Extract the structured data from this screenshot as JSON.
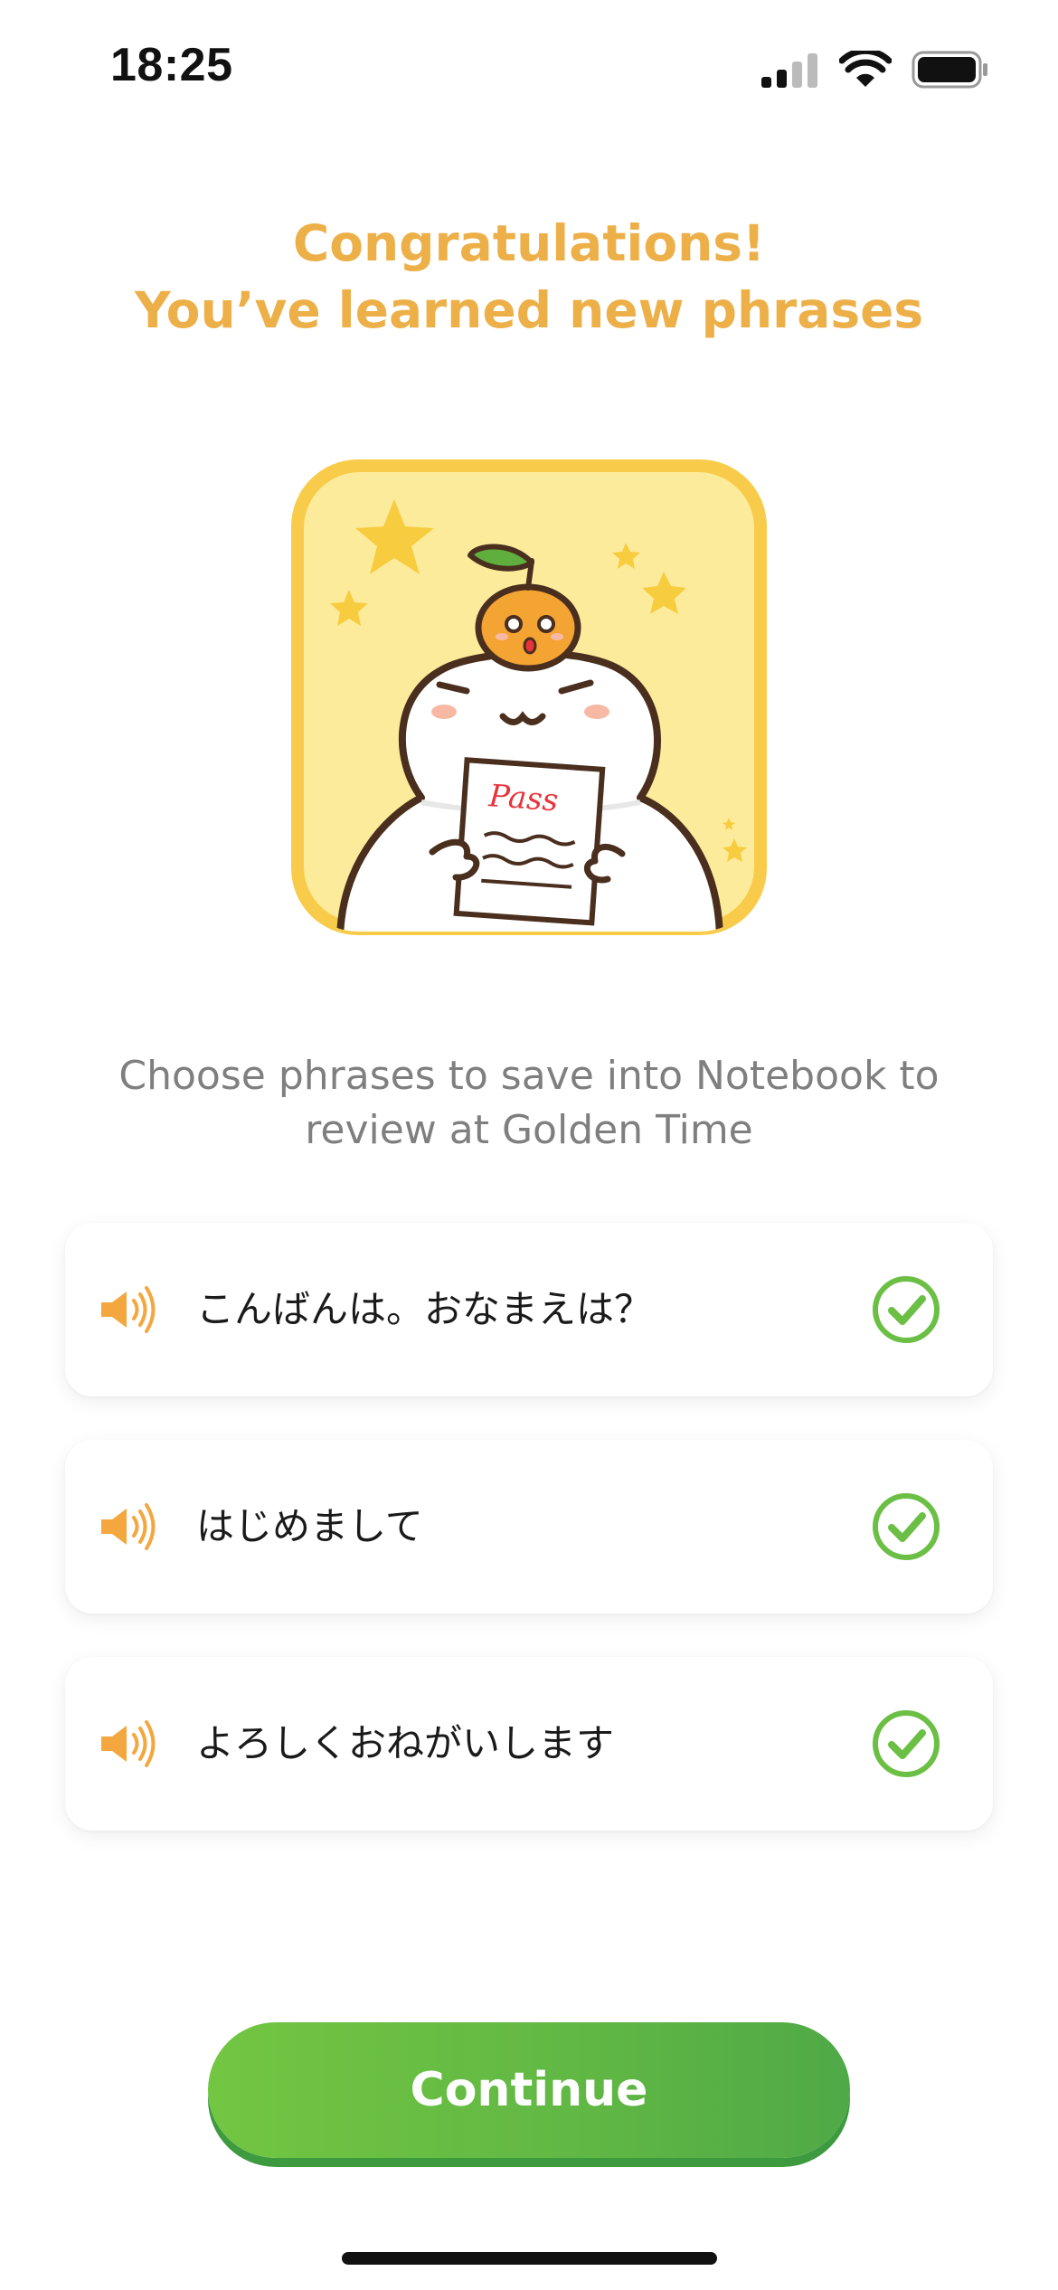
{
  "status_bar": {
    "time": "18:25",
    "icons": [
      "cellular-signal-icon",
      "wifi-icon",
      "battery-icon"
    ]
  },
  "headline": {
    "line1": "Congratulations!",
    "line2": "You’ve learned new phrases"
  },
  "illustration": {
    "name": "mascot-pass-illustration",
    "paper_text": "Pass"
  },
  "instruction": {
    "line1": "Choose phrases to save into Notebook to",
    "line2": "review at Golden Time"
  },
  "phrases": [
    {
      "text": "こんばんは。おなまえは？",
      "selected": true
    },
    {
      "text": "はじめまして",
      "selected": true
    },
    {
      "text": "よろしくおねがいします",
      "selected": true
    }
  ],
  "continue_button": {
    "label": "Continue"
  },
  "colors": {
    "accent_orange": "#EDB049",
    "check_green": "#6CBF45",
    "button_green": "#60B744",
    "card_yellow": "#FDEB9C",
    "card_border": "#F8CC4A"
  }
}
